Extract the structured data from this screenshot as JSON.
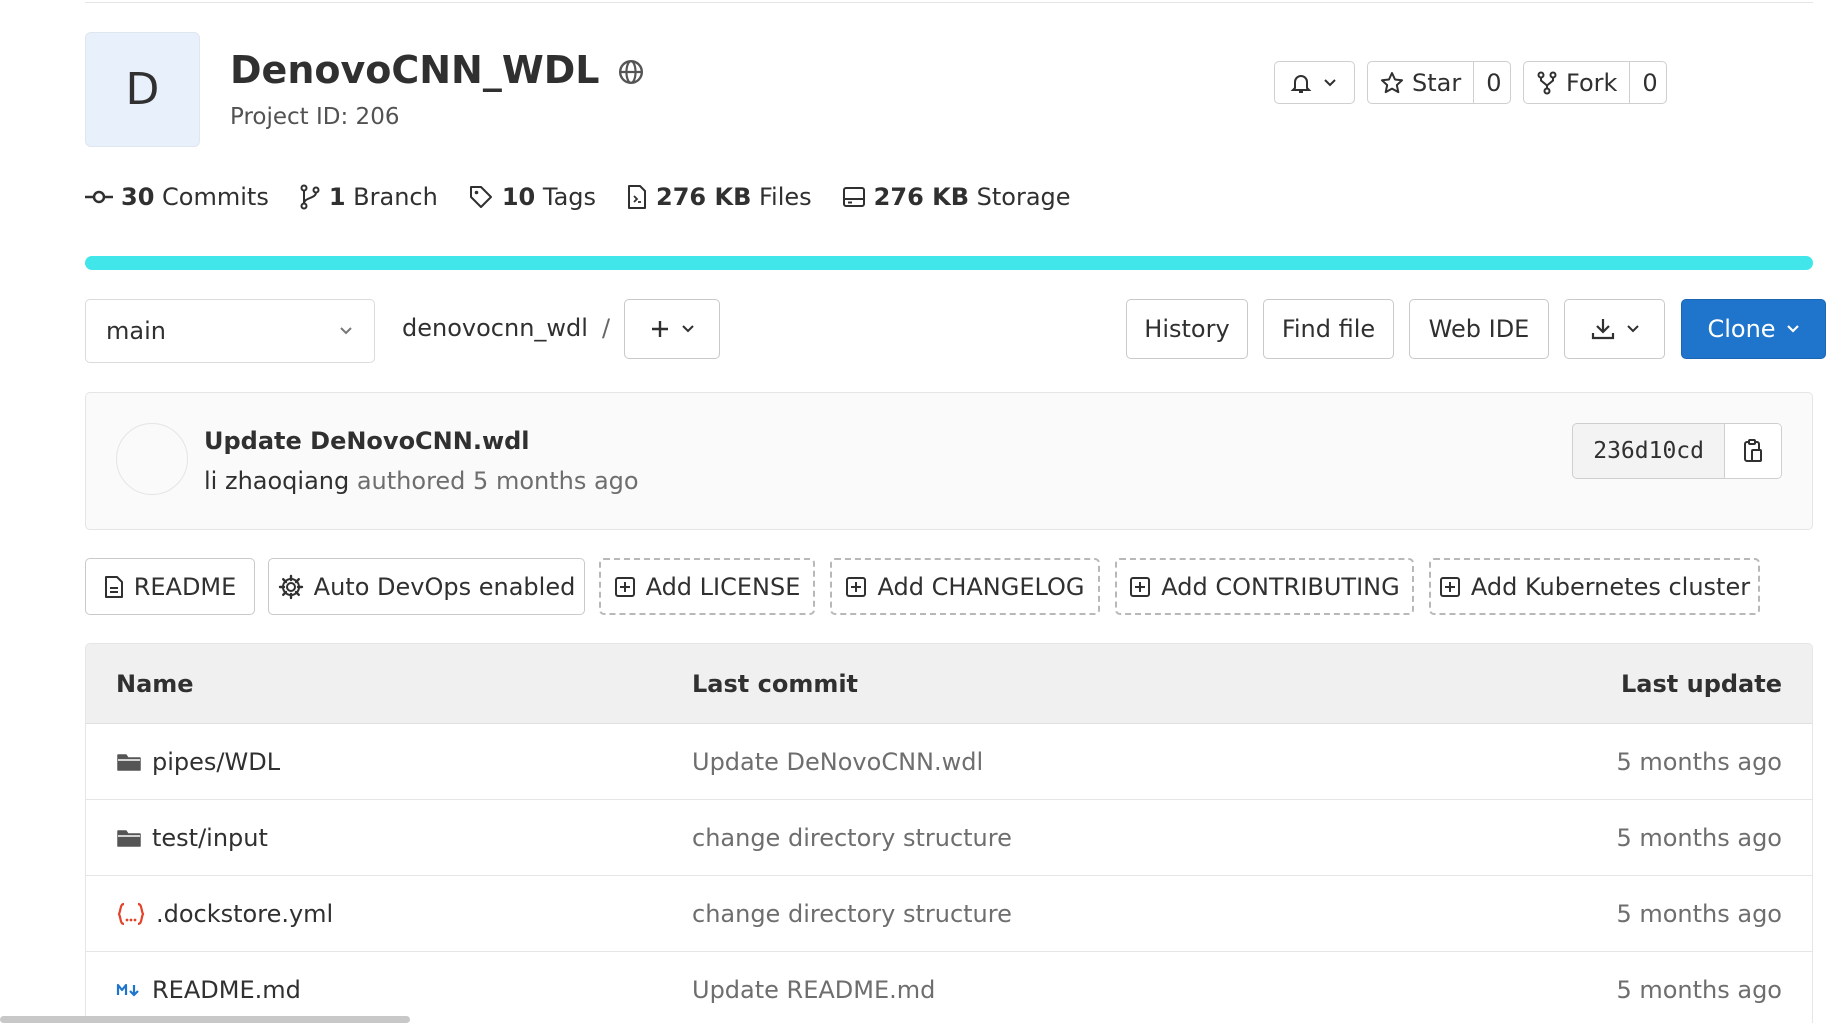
{
  "project": {
    "avatar_letter": "D",
    "name": "DenovoCNN_WDL",
    "project_id": "Project ID: 206"
  },
  "header_actions": {
    "star_label": "Star",
    "star_count": "0",
    "fork_label": "Fork",
    "fork_count": "0"
  },
  "stats": [
    {
      "value": "30",
      "label": "Commits",
      "icon": "commit-icon"
    },
    {
      "value": "1",
      "label": "Branch",
      "icon": "branch-icon"
    },
    {
      "value": "10",
      "label": "Tags",
      "icon": "tag-icon"
    },
    {
      "value": "276 KB",
      "label": "Files",
      "icon": "file-icon"
    },
    {
      "value": "276 KB",
      "label": "Storage",
      "icon": "storage-icon"
    }
  ],
  "language_bar_color": "#41e6ea",
  "toolbar": {
    "branch": "main",
    "path_root": "denovocnn_wdl",
    "path_sep": "/",
    "history_label": "History",
    "find_file_label": "Find file",
    "web_ide_label": "Web IDE",
    "clone_label": "Clone"
  },
  "last_commit": {
    "title": "Update DeNovoCNN.wdl",
    "author": "li zhaoqiang",
    "meta": " authored 5 months ago",
    "sha": "236d10cd"
  },
  "quick_actions": [
    {
      "label": "README",
      "icon": "doc-icon"
    },
    {
      "label": "Auto DevOps enabled",
      "icon": "gear-icon"
    },
    {
      "label": "Add LICENSE",
      "icon": "plus-square-icon"
    },
    {
      "label": "Add CHANGELOG",
      "icon": "plus-square-icon"
    },
    {
      "label": "Add CONTRIBUTING",
      "icon": "plus-square-icon"
    },
    {
      "label": "Add Kubernetes cluster",
      "icon": "plus-square-icon"
    }
  ],
  "table": {
    "headers": {
      "name": "Name",
      "last_commit": "Last commit",
      "last_update": "Last update"
    },
    "rows": [
      {
        "name": "pipes/WDL",
        "icon": "folder-icon",
        "commit": "Update DeNovoCNN.wdl",
        "updated": "5 months ago"
      },
      {
        "name": "test/input",
        "icon": "folder-icon",
        "commit": "change directory structure",
        "updated": "5 months ago"
      },
      {
        "name": ".dockstore.yml",
        "icon": "yaml-icon",
        "commit": "change directory structure",
        "updated": "5 months ago"
      },
      {
        "name": "README.md",
        "icon": "markdown-icon",
        "commit": "Update README.md",
        "updated": "5 months ago"
      }
    ]
  },
  "colors": {
    "primary": "#1f75cb",
    "yaml_icon": "#e24329",
    "markdown_icon": "#1f75cb"
  }
}
